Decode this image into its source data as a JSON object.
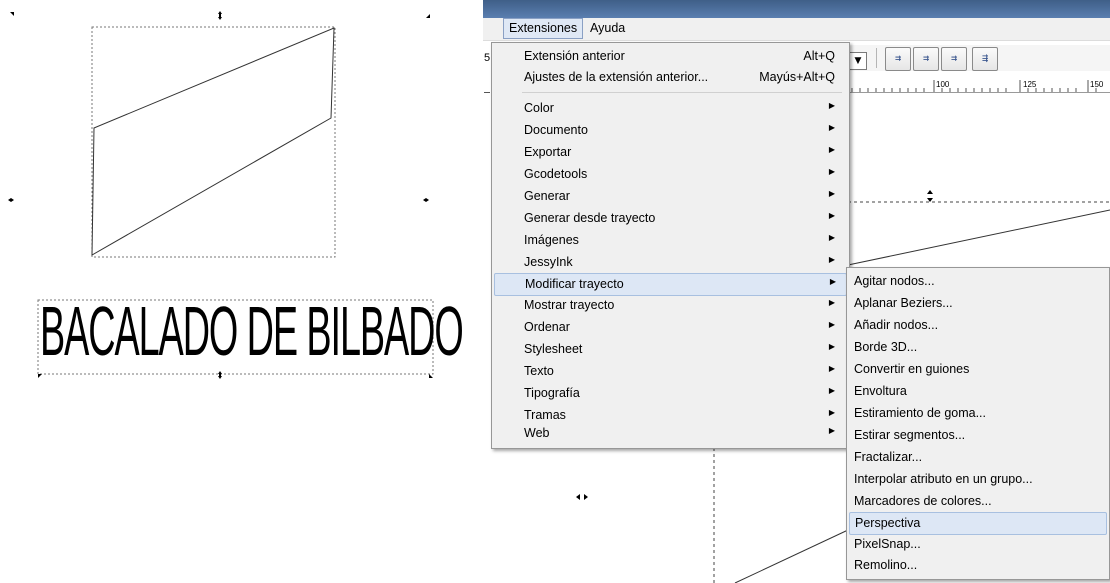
{
  "canvas": {
    "big_text": "BACALADO DE BILBADO"
  },
  "menubar": {
    "items": [
      {
        "label": "Extensiones",
        "active": true
      },
      {
        "label": "Ayuda",
        "active": false
      }
    ],
    "left_fragment": "5"
  },
  "toolbar": {
    "buttons": [
      "align-text-icon",
      "align-text-icon",
      "align-text-icon",
      "align-text-icon"
    ]
  },
  "ruler": {
    "labels": [
      "100",
      "125",
      "150"
    ]
  },
  "extensions_menu": {
    "items": [
      {
        "label": "Extensión anterior",
        "accel": "Alt+Q",
        "submenu": false
      },
      {
        "label": "Ajustes de la extensión anterior...",
        "accel": "Mayús+Alt+Q",
        "submenu": false
      },
      {
        "label": "Color",
        "submenu": true
      },
      {
        "label": "Documento",
        "submenu": true
      },
      {
        "label": "Exportar",
        "submenu": true
      },
      {
        "label": "Gcodetools",
        "submenu": true
      },
      {
        "label": "Generar",
        "submenu": true
      },
      {
        "label": "Generar desde trayecto",
        "submenu": true
      },
      {
        "label": "Imágenes",
        "submenu": true
      },
      {
        "label": "JessyInk",
        "submenu": true
      },
      {
        "label": "Modificar trayecto",
        "submenu": true,
        "highlighted": true
      },
      {
        "label": "Mostrar trayecto",
        "submenu": true
      },
      {
        "label": "Ordenar",
        "submenu": true
      },
      {
        "label": "Stylesheet",
        "submenu": true
      },
      {
        "label": "Texto",
        "submenu": true
      },
      {
        "label": "Tipografía",
        "submenu": true
      },
      {
        "label": "Tramas",
        "submenu": true
      },
      {
        "label": "Web",
        "submenu": true
      }
    ]
  },
  "modify_path_submenu": {
    "items": [
      {
        "label": "Agitar nodos..."
      },
      {
        "label": "Aplanar Beziers..."
      },
      {
        "label": "Añadir nodos..."
      },
      {
        "label": "Borde 3D..."
      },
      {
        "label": "Convertir en guiones"
      },
      {
        "label": "Envoltura"
      },
      {
        "label": "Estiramiento de goma..."
      },
      {
        "label": "Estirar segmentos..."
      },
      {
        "label": "Fractalizar..."
      },
      {
        "label": "Interpolar atributo en un grupo..."
      },
      {
        "label": "Marcadores de colores..."
      },
      {
        "label": "Perspectiva",
        "highlighted": true
      },
      {
        "label": "PixelSnap..."
      },
      {
        "label": "Remolino..."
      }
    ]
  }
}
